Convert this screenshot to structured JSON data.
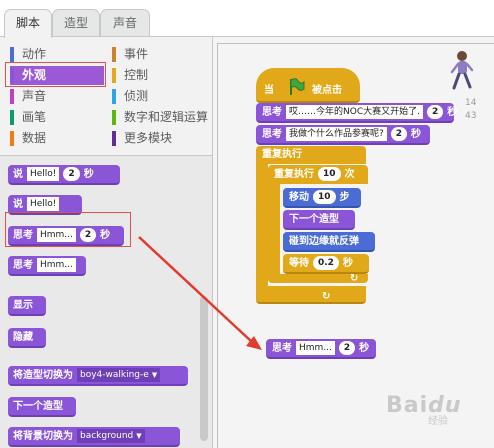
{
  "tabs": [
    "脚本",
    "造型",
    "声音"
  ],
  "categories": [
    {
      "label": "动作",
      "color": "#4a6cd4"
    },
    {
      "label": "事件",
      "color": "#c88330"
    },
    {
      "label": "外观",
      "color": "#8a55d7",
      "selected": true
    },
    {
      "label": "控制",
      "color": "#e1a91a"
    },
    {
      "label": "声音",
      "color": "#bb42c3"
    },
    {
      "label": "侦测",
      "color": "#2ca5e2"
    },
    {
      "label": "画笔",
      "color": "#0e9a6c"
    },
    {
      "label": "数字和逻辑运算",
      "color": "#5cb712"
    },
    {
      "label": "数据",
      "color": "#ee7d16"
    },
    {
      "label": "更多模块",
      "color": "#632d99"
    }
  ],
  "palette_blocks": {
    "say_secs": {
      "label": "说",
      "text": "Hello!",
      "secs": "2",
      "unit": "秒"
    },
    "say": {
      "label": "说",
      "text": "Hello!"
    },
    "think_secs": {
      "label": "思考",
      "text": "Hmm...",
      "secs": "2",
      "unit": "秒"
    },
    "think": {
      "label": "思考",
      "text": "Hmm..."
    },
    "show": "显示",
    "hide": "隐藏",
    "switch_costume": {
      "label": "将造型切换为",
      "value": "boy4-walking-e"
    },
    "next_costume": "下一个造型",
    "switch_backdrop": {
      "label": "将背景切换为",
      "value": "background"
    }
  },
  "script": {
    "hat_prefix": "当",
    "hat_suffix": "被点击",
    "say1": {
      "label": "思考",
      "text": "哎……今年的NOC大赛又开始了.",
      "secs": "2",
      "unit": "秒"
    },
    "say2": {
      "label": "思考",
      "text": "我做个什么作品参赛呢?",
      "secs": "2",
      "unit": "秒"
    },
    "forever": "重复执行",
    "repeat": {
      "label": "重复执行",
      "count": "10",
      "unit": "次"
    },
    "move": {
      "label": "移动",
      "steps": "10",
      "unit": "步"
    },
    "next_costume": "下一个造型",
    "bounce": "碰到边缘就反弹",
    "wait": {
      "label": "等待",
      "secs": "0.2",
      "unit": "秒"
    },
    "dragged": {
      "label": "思考",
      "text": "Hmm...",
      "secs": "2",
      "unit": "秒"
    }
  },
  "stage_numbers": {
    "a": "14",
    "b": "43"
  },
  "watermark": {
    "brand": "Bai",
    "du": "du",
    "suffix": "经验"
  }
}
